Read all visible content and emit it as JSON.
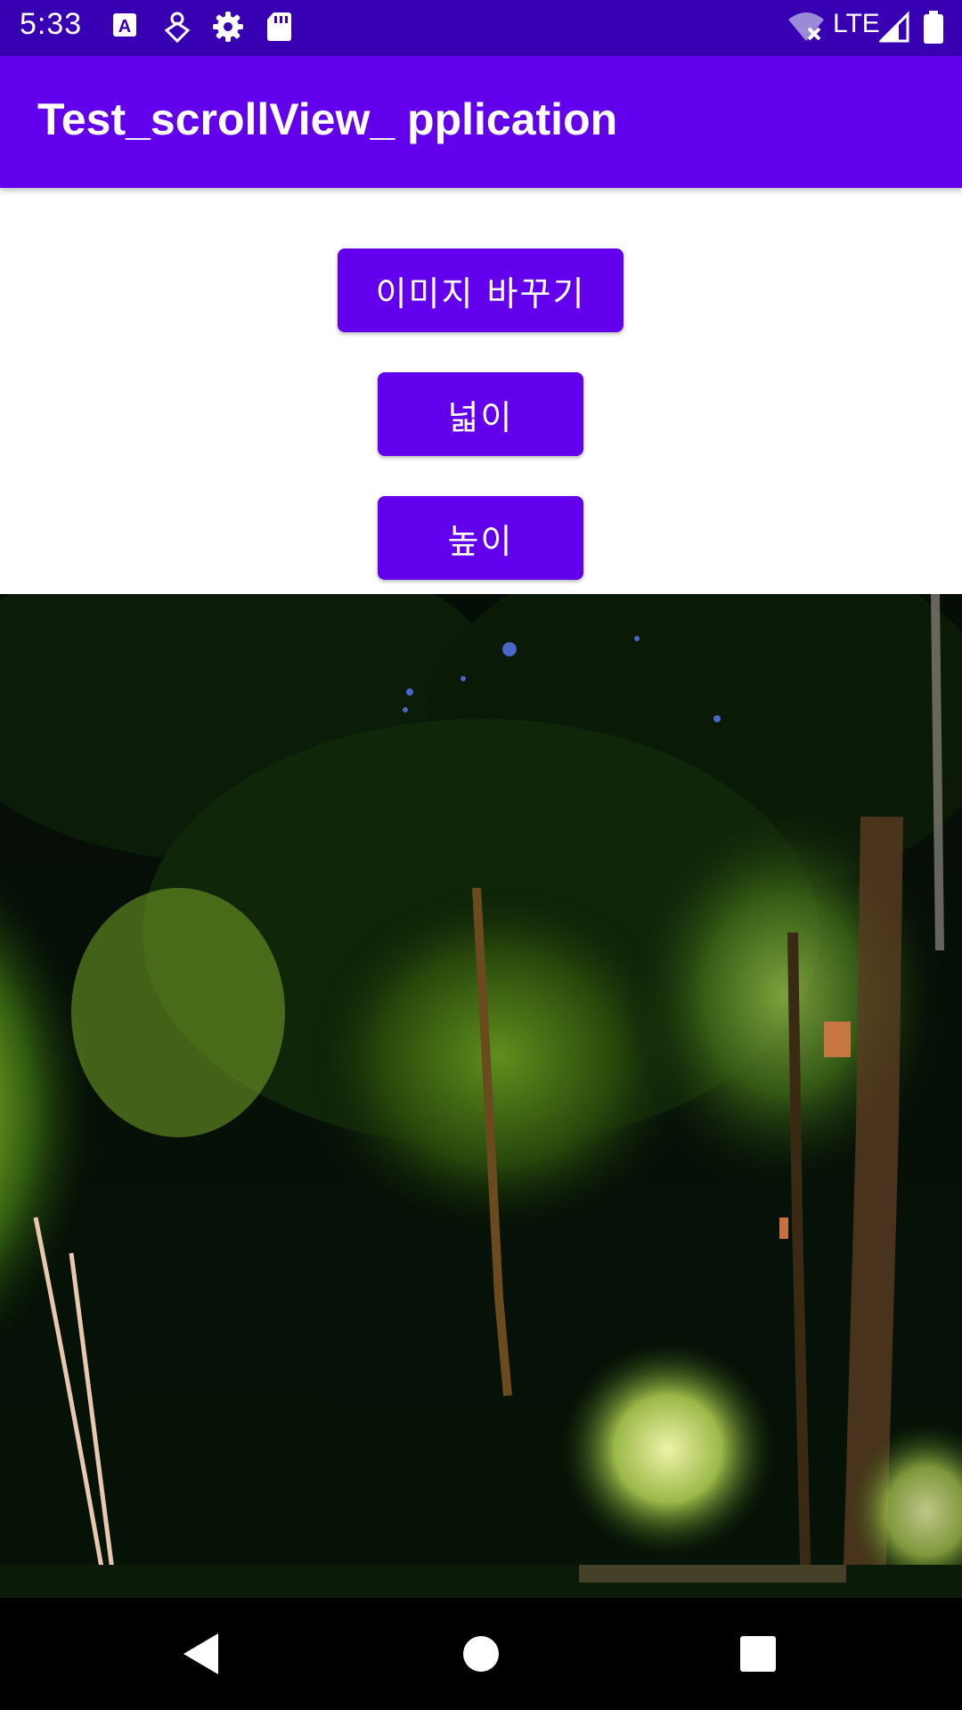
{
  "status_bar": {
    "time": "5:33",
    "network": "LTE",
    "left_icons": [
      "a-icon",
      "location-pin-icon",
      "settings-icon",
      "sd-card-icon"
    ],
    "right_icons": [
      "wifi-off-icon",
      "signal-icon",
      "battery-icon"
    ],
    "background": "#3700B3"
  },
  "app_bar": {
    "title": "Test_scrollView_ pplication",
    "background": "#6200EE"
  },
  "buttons": {
    "change_image": "이미지 바꾸기",
    "width": "넓이",
    "height": "높이",
    "color": "#6200EE"
  },
  "image": {
    "subject": "night-forest-photo"
  },
  "nav_bar": {
    "icons": [
      "back-icon",
      "home-icon",
      "recents-icon"
    ]
  }
}
